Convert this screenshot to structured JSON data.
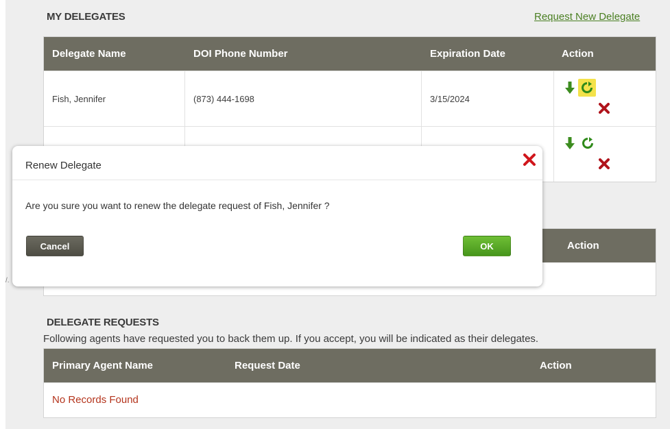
{
  "my_delegates": {
    "title": "MY DELEGATES",
    "request_link": "Request New Delegate",
    "columns": [
      "Delegate Name",
      "DOI Phone Number",
      "Expiration Date",
      "Action"
    ],
    "rows": [
      {
        "name": "Fish, Jennifer",
        "phone": "(873) 444-1698",
        "expiration": "3/15/2024"
      },
      {
        "name": "",
        "phone": "",
        "expiration": ""
      }
    ]
  },
  "middle_table": {
    "action_header": "Action"
  },
  "delegate_requests": {
    "title": "DELEGATE REQUESTS",
    "description": "Following agents have requested you to back them up. If you accept, you will be indicated as their delegates.",
    "columns": [
      "Primary Agent Name",
      "Request Date",
      "Action"
    ],
    "empty_text": "No Records Found"
  },
  "modal": {
    "title": "Renew Delegate",
    "message": "Are you sure you want to renew the delegate request of Fish, Jennifer ?",
    "cancel_label": "Cancel",
    "ok_label": "OK"
  },
  "stray_text": "/.",
  "colors": {
    "header_bg": "#6e6d61",
    "link": "#4a7f22",
    "ok_button": "#5aad26",
    "cancel_button": "#5c5b51",
    "error_text": "#b4341c",
    "highlight": "#f4e24a"
  },
  "icons": {
    "download": "down-arrow-icon",
    "renew": "renew-icon",
    "delete": "delete-x-icon",
    "close": "close-x-icon"
  }
}
